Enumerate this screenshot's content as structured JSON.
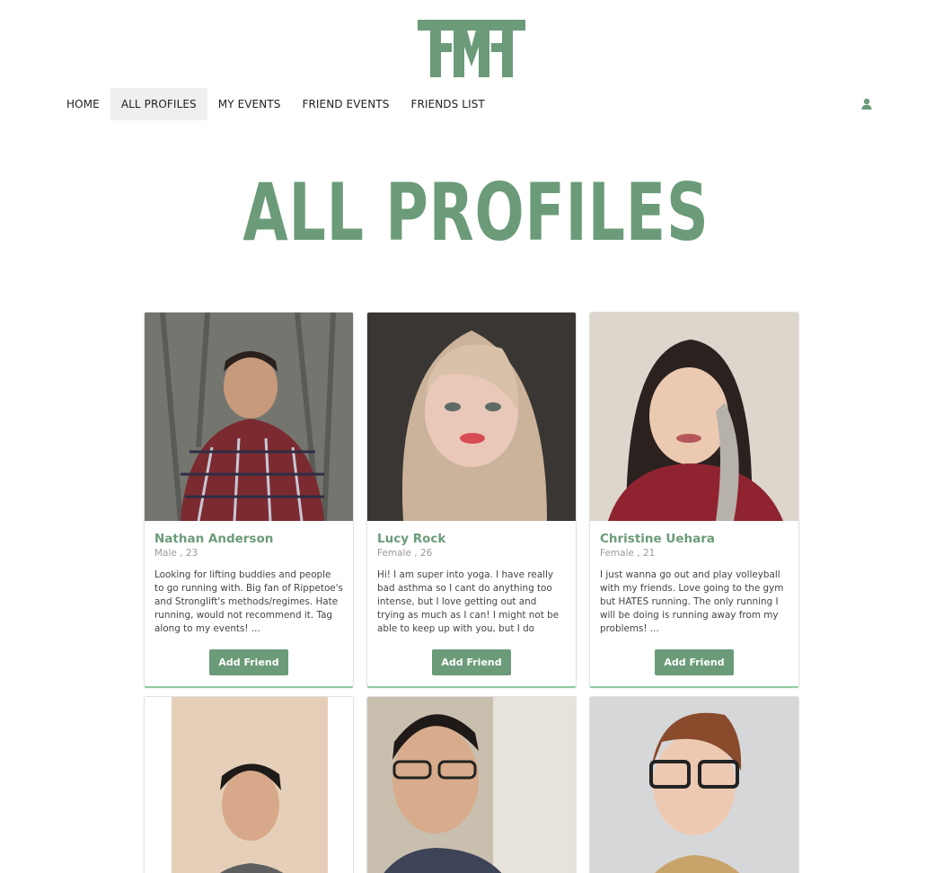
{
  "nav": {
    "items": [
      {
        "label": "HOME"
      },
      {
        "label": "ALL PROFILES"
      },
      {
        "label": "MY EVENTS"
      },
      {
        "label": "FRIEND EVENTS"
      },
      {
        "label": "FRIENDS LIST"
      }
    ],
    "active": "ALL PROFILES",
    "user_icon": "user-icon"
  },
  "logo": {
    "icon": "fmf-logo",
    "color": "#6b9b79"
  },
  "title": "ALL PROFILES",
  "colors": {
    "accent": "#6b9b79",
    "card_border_bottom": "#8fcc9e"
  },
  "profiles": [
    {
      "name": "Nathan Anderson",
      "meta": "Male , 23",
      "bio": "Looking for lifting buddies and people to go running with. Big fan of Rippetoe's and Stronglift's methods/regimes. Hate running, would not recommend it. Tag along to my events! ...",
      "button": "Add Friend"
    },
    {
      "name": "Lucy Rock",
      "meta": "Female , 26",
      "bio": "Hi! I am super into yoga. I have really bad asthma so I cant do anything too intense, but I love getting out and trying as much as I can! I might not be able to keep up with you, but I do provide unhe ...",
      "button": "Add Friend"
    },
    {
      "name": "Christine Uehara",
      "meta": "Female , 21",
      "bio": "I just wanna go out and play volleyball with my friends. Love going to the gym but HATES running. The only running I will be doing is running away from my problems! ...",
      "button": "Add Friend"
    }
  ]
}
